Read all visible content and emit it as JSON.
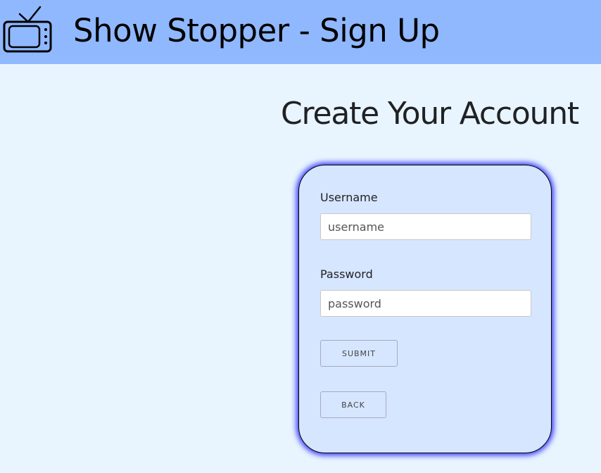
{
  "header": {
    "title": "Show Stopper - Sign Up",
    "icon": "tv-icon",
    "background": "#90b8ff"
  },
  "main": {
    "heading": "Create Your Account"
  },
  "form": {
    "username_label": "Username",
    "username_value": "",
    "username_placeholder": "username",
    "password_label": "Password",
    "password_value": "",
    "password_placeholder": "password",
    "submit_label": "SUBMIT",
    "back_label": "BACK",
    "card_background": "#d6e6ff",
    "card_glow": "#3a3aff"
  }
}
